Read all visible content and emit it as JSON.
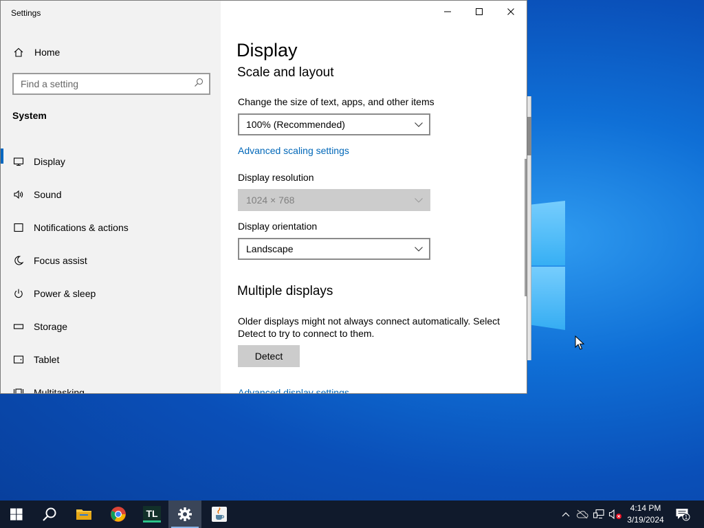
{
  "window": {
    "title": "Settings"
  },
  "sidebar": {
    "home_label": "Home",
    "search_placeholder": "Find a setting",
    "section_label": "System",
    "items": [
      {
        "label": "Display",
        "icon": "monitor-icon",
        "active": true
      },
      {
        "label": "Sound",
        "icon": "speaker-icon"
      },
      {
        "label": "Notifications & actions",
        "icon": "notification-icon"
      },
      {
        "label": "Focus assist",
        "icon": "moon-icon"
      },
      {
        "label": "Power & sleep",
        "icon": "power-icon"
      },
      {
        "label": "Storage",
        "icon": "storage-icon"
      },
      {
        "label": "Tablet",
        "icon": "tablet-icon"
      },
      {
        "label": "Multitasking",
        "icon": "multitasking-icon"
      }
    ]
  },
  "content": {
    "page_title": "Display",
    "scale_section": "Scale and layout",
    "scale_label": "Change the size of text, apps, and other items",
    "scale_value": "100% (Recommended)",
    "advanced_scaling_link": "Advanced scaling settings",
    "resolution_label": "Display resolution",
    "resolution_value": "1024 × 768",
    "orientation_label": "Display orientation",
    "orientation_value": "Landscape",
    "multiple_section": "Multiple displays",
    "multiple_text": "Older displays might not always connect automatically. Select Detect to try to connect to them.",
    "detect_button": "Detect",
    "advanced_display_link": "Advanced display settings"
  },
  "taskbar": {
    "apps": [
      "start-icon",
      "search-icon",
      "file-explorer-icon",
      "chrome-icon",
      "tl-app-icon",
      "settings-icon",
      "java-icon"
    ],
    "tl_label": "TL",
    "time": "4:14 PM",
    "date": "3/19/2024",
    "notification_count": "1"
  },
  "colors": {
    "accent": "#0067c0",
    "link": "#0067b8",
    "taskbar": "#101a2c"
  }
}
